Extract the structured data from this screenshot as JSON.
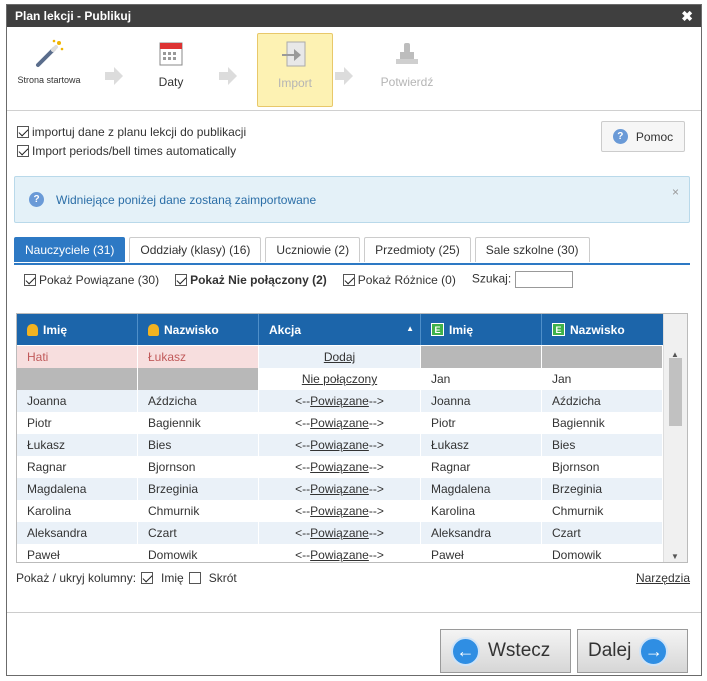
{
  "window": {
    "title": "Plan lekcji - Publikuj",
    "close_glyph": "✖"
  },
  "wizard": {
    "steps": [
      {
        "label": "Strona startowa",
        "icon": "magic-wand-icon",
        "state": "done"
      },
      {
        "label": "Daty",
        "icon": "calendar-icon",
        "state": "done"
      },
      {
        "label": "Import",
        "icon": "import-icon",
        "state": "active"
      },
      {
        "label": "Potwierdź",
        "icon": "stamp-icon",
        "state": "disabled"
      }
    ]
  },
  "options": {
    "import_data_label": "importuj dane z planu lekcji do publikacji",
    "import_data_checked": true,
    "import_periods_label": "Import periods/bell times automatically",
    "import_periods_checked": true,
    "help_label": "Pomoc",
    "help_icon": "?"
  },
  "info": {
    "message": "Widniejące poniżej dane zostaną zaimportowane",
    "icon": "?",
    "close_glyph": "×"
  },
  "tabs": [
    {
      "label": "Nauczyciele (31)",
      "active": true
    },
    {
      "label": "Oddziały (klasy) (16)",
      "active": false
    },
    {
      "label": "Uczniowie (2)",
      "active": false
    },
    {
      "label": "Przedmioty (25)",
      "active": false
    },
    {
      "label": "Sale szkolne (30)",
      "active": false
    }
  ],
  "filters": {
    "show_linked": "Pokaż Powiązane (30)",
    "show_unlinked": "Pokaż Nie połączony (2)",
    "show_diff": "Pokaż Różnice (0)",
    "search_label": "Szukaj:",
    "search_value": ""
  },
  "grid": {
    "headers": {
      "first_name": "Imię",
      "last_name": "Nazwisko",
      "action": "Akcja",
      "ext_first_name": "Imię",
      "ext_last_name": "Nazwisko",
      "sort_glyph": "▲",
      "ext_glyph": "E"
    },
    "rows": [
      {
        "first": "Hati",
        "last": "Łukasz",
        "action_mid": "Dodaj",
        "ext_first": "",
        "ext_last": ""
      },
      {
        "first": "",
        "last": "",
        "action_mid": "Nie połączony",
        "ext_first": "Jan",
        "ext_last": "Jan"
      },
      {
        "first": "Joanna",
        "last": "Aździcha",
        "action_pre": "<-- ",
        "action_mid": "Powiązane",
        "action_post": " -->",
        "ext_first": "Joanna",
        "ext_last": "Aździcha"
      },
      {
        "first": "Piotr",
        "last": "Bagiennik",
        "action_pre": "<-- ",
        "action_mid": "Powiązane",
        "action_post": " -->",
        "ext_first": "Piotr",
        "ext_last": "Bagiennik"
      },
      {
        "first": "Łukasz",
        "last": "Bies",
        "action_pre": "<-- ",
        "action_mid": "Powiązane",
        "action_post": " -->",
        "ext_first": "Łukasz",
        "ext_last": "Bies"
      },
      {
        "first": "Ragnar",
        "last": "Bjornson",
        "action_pre": "<-- ",
        "action_mid": "Powiązane",
        "action_post": " -->",
        "ext_first": "Ragnar",
        "ext_last": "Bjornson"
      },
      {
        "first": "Magdalena",
        "last": "Brzeginia",
        "action_pre": "<-- ",
        "action_mid": "Powiązane",
        "action_post": " -->",
        "ext_first": "Magdalena",
        "ext_last": "Brzeginia"
      },
      {
        "first": "Karolina",
        "last": "Chmurnik",
        "action_pre": "<-- ",
        "action_mid": "Powiązane",
        "action_post": " -->",
        "ext_first": "Karolina",
        "ext_last": "Chmurnik"
      },
      {
        "first": "Aleksandra",
        "last": "Czart",
        "action_pre": "<-- ",
        "action_mid": "Powiązane",
        "action_post": " -->",
        "ext_first": "Aleksandra",
        "ext_last": "Czart"
      },
      {
        "first": "Paweł",
        "last": "Domowik",
        "action_pre": "<-- ",
        "action_mid": "Powiązane",
        "action_post": " -->",
        "ext_first": "Paweł",
        "ext_last": "Domowik"
      }
    ]
  },
  "columns_toggle": {
    "label": "Pokaż / ukryj kolumny:",
    "first_name": "Imię",
    "first_name_checked": true,
    "short": "Skrót",
    "short_checked": false,
    "tools": "Narzędzia"
  },
  "nav": {
    "back": "Wstecz",
    "next": "Dalej",
    "back_glyph": "←",
    "next_glyph": "→"
  },
  "colors": {
    "header_blue": "#1c65aa",
    "tab_active": "#2d79c4",
    "info_text": "#2b6ea7",
    "unlinked_pink": "#f7dede"
  }
}
